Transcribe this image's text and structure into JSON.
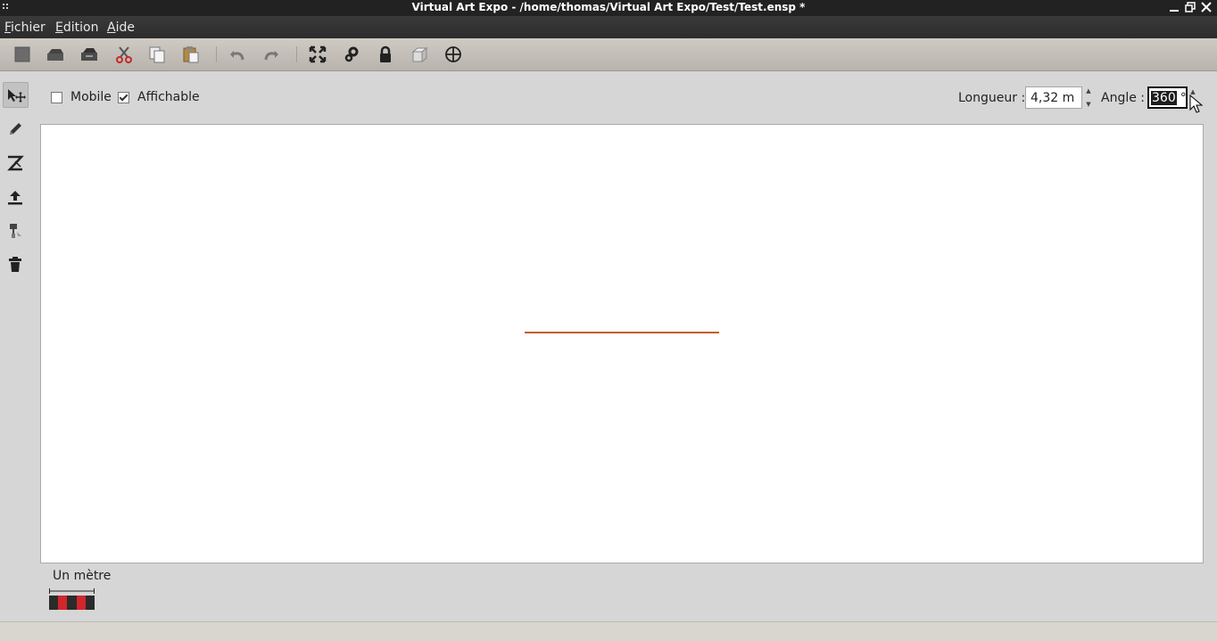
{
  "window": {
    "title": "Virtual Art Expo - /home/thomas/Virtual Art Expo/Test/Test.ensp *",
    "buttons": [
      "minimize-icon",
      "restore-icon",
      "close-icon"
    ]
  },
  "menubar": {
    "items": [
      {
        "label": "Fichier"
      },
      {
        "label": "Edition"
      },
      {
        "label": "Aide"
      }
    ]
  },
  "toolbar": {
    "icons": [
      "new-icon",
      "open-icon",
      "save-icon",
      "cut-icon",
      "copy-icon",
      "paste-icon",
      "undo-icon",
      "redo-icon",
      "fullscreen-icon",
      "settings-icon",
      "lock-icon",
      "3d-view-icon",
      "target-icon"
    ]
  },
  "sidebar": {
    "tools": [
      "select-move-icon",
      "pencil-icon",
      "wall-tool-icon",
      "upload-icon",
      "paint-icon",
      "trash-icon"
    ],
    "active": "select-move-icon"
  },
  "options": {
    "mobile": {
      "label": "Mobile",
      "checked": false
    },
    "affichable": {
      "label": "Affichable",
      "checked": true
    }
  },
  "properties": {
    "length_label": "Longueur :",
    "length_value": "4,32 m",
    "angle_label": "Angle :",
    "angle_value": "360",
    "angle_unit": "°"
  },
  "scale": {
    "label": "Un mètre"
  },
  "colors": {
    "wall": "#c75b12",
    "scale_dark": "#2b2b2b",
    "scale_red": "#d0262c"
  }
}
